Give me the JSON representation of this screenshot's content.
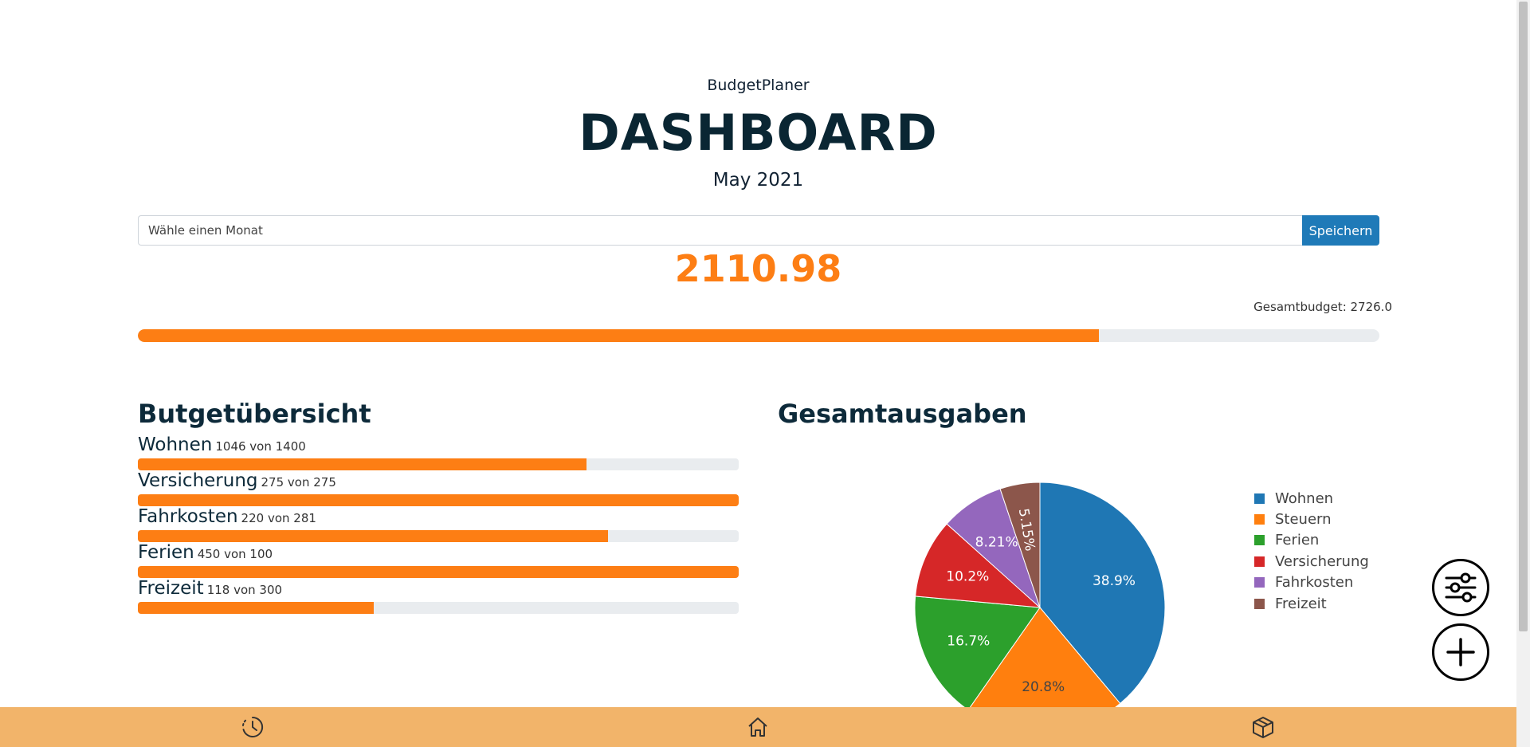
{
  "header": {
    "brand": "BudgetPlaner",
    "title": "DASHBOARD",
    "month": "May 2021"
  },
  "month_picker": {
    "placeholder": "Wähle einen Monat",
    "save_label": "Speichern"
  },
  "summary": {
    "spent": "2110.98",
    "total_budget_label": "Gesamtbudget: 2726.0",
    "progress_fraction": 0.774
  },
  "overview": {
    "title": "Butgetübersicht",
    "items": [
      {
        "name": "Wohnen",
        "amount": "1046 von 1400",
        "fraction": 0.747
      },
      {
        "name": "Versicherung",
        "amount": "275 von 275",
        "fraction": 1.0
      },
      {
        "name": "Fahrkosten",
        "amount": "220 von 281",
        "fraction": 0.783
      },
      {
        "name": "Ferien",
        "amount": "450 von 100",
        "fraction": 1.0
      },
      {
        "name": "Freizeit",
        "amount": "118 von 300",
        "fraction": 0.393
      }
    ]
  },
  "expenses": {
    "title": "Gesamtausgaben"
  },
  "chart_data": {
    "type": "pie",
    "title": "Gesamtausgaben",
    "labels": [
      "Wohnen",
      "Steuern",
      "Ferien",
      "Versicherung",
      "Fahrkosten",
      "Freizeit"
    ],
    "values": [
      38.9,
      20.8,
      16.7,
      10.2,
      8.21,
      5.15
    ],
    "value_labels": [
      "38.9%",
      "20.8%",
      "16.7%",
      "10.2%",
      "8.21%",
      "5.15%"
    ],
    "colors": [
      "#1f77b4",
      "#ff7f0e",
      "#2ca02c",
      "#d62728",
      "#9467bd",
      "#8c564b"
    ],
    "legend_position": "right"
  },
  "fabs": {
    "filter_icon": "sliders-icon",
    "add_icon": "plus-icon"
  },
  "bottom_nav": {
    "items": [
      "history-icon",
      "home-icon",
      "box-icon"
    ]
  },
  "colors": {
    "accent": "#fd7e14",
    "primary_button": "#1f7ab8",
    "nav_background": "#f2b46a",
    "track": "#e9ecef"
  }
}
